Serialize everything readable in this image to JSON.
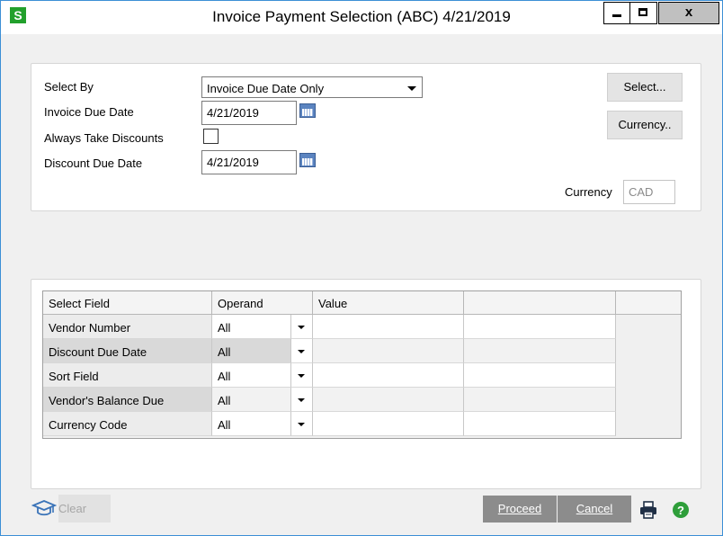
{
  "window": {
    "app_icon": "S",
    "title": "Invoice Payment Selection (ABC) 4/21/2019",
    "close_glyph": "x"
  },
  "form": {
    "select_by_label": "Select By",
    "select_by_value": "Invoice Due Date Only",
    "invoice_due_date_label": "Invoice Due Date",
    "invoice_due_date_value": "4/21/2019",
    "always_take_discounts_label": "Always Take Discounts",
    "always_take_discounts_checked": false,
    "discount_due_date_label": "Discount Due Date",
    "discount_due_date_value": "4/21/2019",
    "select_button": "Select...",
    "currency_button": "Currency..",
    "currency_label": "Currency",
    "currency_value": "CAD"
  },
  "grid": {
    "headers": [
      "Select Field",
      "Operand",
      "Value",
      ""
    ],
    "rows": [
      {
        "field": "Vendor Number",
        "operand": "All",
        "value": ""
      },
      {
        "field": "Discount Due Date",
        "operand": "All",
        "value": ""
      },
      {
        "field": "Sort Field",
        "operand": "All",
        "value": ""
      },
      {
        "field": "Vendor's Balance Due",
        "operand": "All",
        "value": ""
      },
      {
        "field": "Currency Code",
        "operand": "All",
        "value": ""
      }
    ]
  },
  "footer": {
    "clear_button": "Clear",
    "proceed_button": "Proceed",
    "cancel_button": "Cancel"
  },
  "icons": {
    "app": "sage-logo-icon",
    "help": "help-icon",
    "print": "printer-icon",
    "learn": "graduation-cap-icon"
  },
  "colors": {
    "app_icon_bg": "#22a02c",
    "window_border": "#3c8fd6",
    "help_icon": "#2e9e3a",
    "action_button_bg": "#8c8c8c"
  }
}
